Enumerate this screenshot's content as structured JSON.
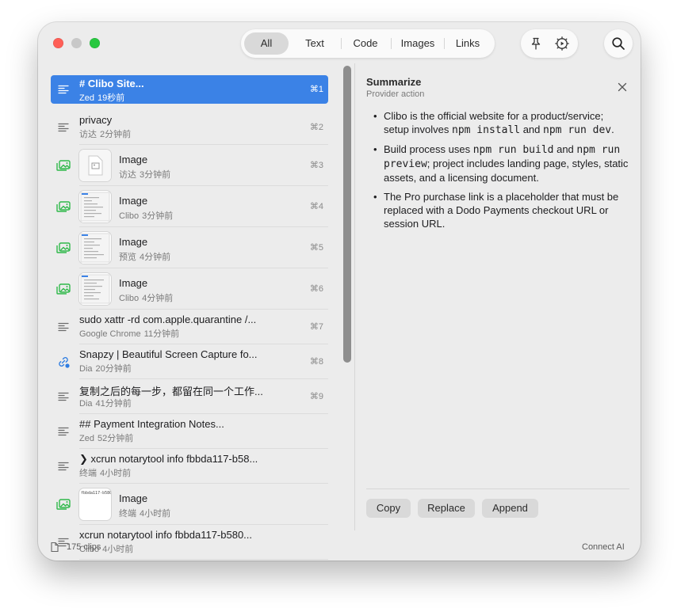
{
  "toolbar": {
    "tabs": [
      {
        "label": "All"
      },
      {
        "label": "Text"
      },
      {
        "label": "Code"
      },
      {
        "label": "Images"
      },
      {
        "label": "Links"
      }
    ],
    "active_tab": "All",
    "buttons": {
      "pin": "pin-icon",
      "settings": "gear-play-icon",
      "search": "search-icon"
    }
  },
  "clips": [
    {
      "type": "text",
      "title": "# Clibo Site...",
      "app": "Zed",
      "time": "19秒前",
      "shortcut": "⌘1",
      "selected": true
    },
    {
      "type": "text",
      "title": "privacy",
      "app": "访达",
      "time": "2分钟前",
      "shortcut": "⌘2"
    },
    {
      "type": "image",
      "title": "Image",
      "app": "访达",
      "time": "3分钟前",
      "shortcut": "⌘3"
    },
    {
      "type": "image",
      "title": "Image",
      "app": "Clibo",
      "time": "3分钟前",
      "shortcut": "⌘4"
    },
    {
      "type": "image",
      "title": "Image",
      "app": "预览",
      "time": "4分钟前",
      "shortcut": "⌘5"
    },
    {
      "type": "image",
      "title": "Image",
      "app": "Clibo",
      "time": "4分钟前",
      "shortcut": "⌘6"
    },
    {
      "type": "text",
      "title": "sudo xattr -rd com.apple.quarantine /...",
      "app": "Google Chrome",
      "time": "11分钟前",
      "shortcut": "⌘7"
    },
    {
      "type": "link",
      "title": "Snapzy | Beautiful Screen Capture fo...",
      "app": "Dia",
      "time": "20分钟前",
      "shortcut": "⌘8"
    },
    {
      "type": "text",
      "title": "复制之后的每一步，都留在同一个工作...",
      "app": "Dia",
      "time": "41分钟前",
      "shortcut": "⌘9"
    },
    {
      "type": "text",
      "title": "## Payment Integration Notes...",
      "app": "Zed",
      "time": "52分钟前",
      "shortcut": ""
    },
    {
      "type": "text",
      "title": "❯ xcrun notarytool info fbbda117-b58...",
      "app": "终端",
      "time": "4小时前",
      "shortcut": ""
    },
    {
      "type": "image",
      "title": "Image",
      "app": "终端",
      "time": "4小时前",
      "shortcut": "",
      "thumb_text": "fbbda117-b580"
    },
    {
      "type": "text",
      "title": "xcrun notarytool info fbbda117-b580...",
      "app": "Clibo",
      "time": "4小时前",
      "shortcut": ""
    }
  ],
  "panel": {
    "title": "Summarize",
    "subtitle": "Provider action",
    "bullets": [
      [
        {
          "t": "Clibo is the official website for a product/service; setup involves "
        },
        {
          "t": "npm install",
          "code": true
        },
        {
          "t": " and "
        },
        {
          "t": "npm run dev",
          "code": true
        },
        {
          "t": "."
        }
      ],
      [
        {
          "t": "Build process uses "
        },
        {
          "t": "npm run build",
          "code": true
        },
        {
          "t": " and "
        },
        {
          "t": "npm run preview",
          "code": true
        },
        {
          "t": "; project includes landing page, styles, static assets, and a licensing document."
        }
      ],
      [
        {
          "t": "The Pro purchase link is a placeholder that must be replaced with a Dodo Payments checkout URL or session URL."
        }
      ]
    ],
    "actions": {
      "copy": "Copy",
      "replace": "Replace",
      "append": "Append"
    }
  },
  "footer": {
    "count": "175 clips",
    "connect": "Connect AI"
  },
  "colors": {
    "accent": "#3b82e6",
    "image_icon": "#2fb84a",
    "link_icon": "#2f7de1"
  }
}
